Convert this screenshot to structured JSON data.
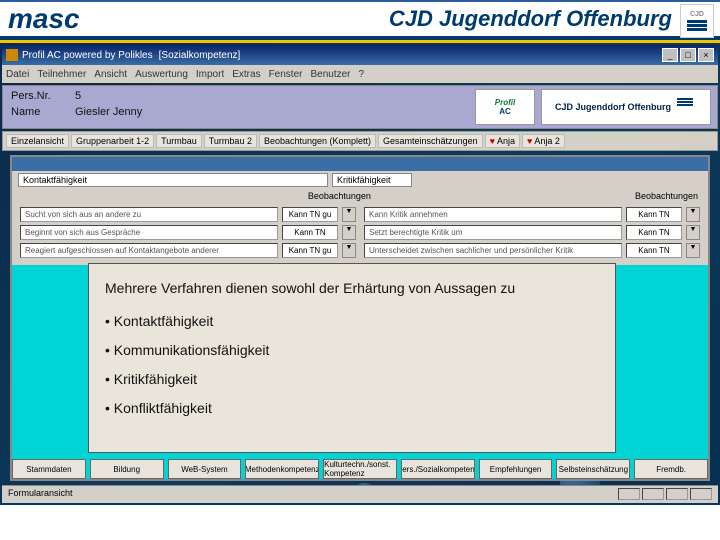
{
  "header": {
    "masc": "masc",
    "title": "CJD Jugenddorf Offenburg",
    "logo_text": "CJD"
  },
  "window": {
    "title": "Profil AC powered by Polikles",
    "subtitle": "[Sozialkompetenz]",
    "menu": [
      "Datei",
      "Teilnehmer",
      "Ansicht",
      "Auswertung",
      "Import",
      "Extras",
      "Fenster",
      "Benutzer",
      "?"
    ],
    "controls": {
      "min": "_",
      "max": "□",
      "close": "×"
    }
  },
  "id": {
    "persnr_label": "Pers.Nr.",
    "persnr": "5",
    "name_label": "Name",
    "name": "Giesler Jenny",
    "cjd_text": "CJD Jugenddorf Offenburg",
    "profil_top": "Profil",
    "profil_bottom": "AC"
  },
  "toolbar": {
    "items": [
      "Einzelansicht",
      "Gruppenarbeit 1-2",
      "Turmbau",
      "Turmbau 2",
      "Beobachtungen (Komplett)",
      "Gesamteinschätzungen",
      "Anja",
      "Anja 2"
    ]
  },
  "sections": {
    "left_title": "Kontaktfähigkeit",
    "right_title": "Kritikfähigkeit",
    "obs_label": "Beobachtungen",
    "obs_label_r": "Beobachtungen"
  },
  "grid": {
    "left": [
      {
        "label": "Sucht von sich aus an andere zu",
        "val": "Kann TN gu"
      },
      {
        "label": "Beginnt von sich aus Gespräche",
        "val": "Kann TN"
      },
      {
        "label": "Reagiert aufgeschlossen auf Kontaktangebote anderer",
        "val": "Kann TN gu"
      }
    ],
    "right": [
      {
        "label": "Kann Kritik annehmen",
        "val": "Kann TN"
      },
      {
        "label": "Setzt berechtigte Kritik um",
        "val": "Kann TN"
      },
      {
        "label": "Unterscheidet zwischen sachlicher und persönlicher Kritik",
        "val": "Kann TN"
      }
    ],
    "arrow": "▼"
  },
  "overlay": {
    "intro": "Mehrere Verfahren dienen sowohl der Erhärtung von Aussagen zu",
    "bullets": [
      "• Kontaktfähigkeit",
      "• Kommunikationsfähigkeit",
      "• Kritikfähigkeit",
      "• Konfliktfähigkeit"
    ]
  },
  "buttons": [
    "Stammdaten",
    "Bildung",
    "WeB-System",
    "Methodenkompetenz",
    "Kulturtechn./sonst. Kompetenz",
    "Pers./Sozialkompetenz",
    "Empfehlungen",
    "Selbsteinschätzung",
    "Fremdb."
  ],
  "status": {
    "label": "Formularansicht"
  }
}
